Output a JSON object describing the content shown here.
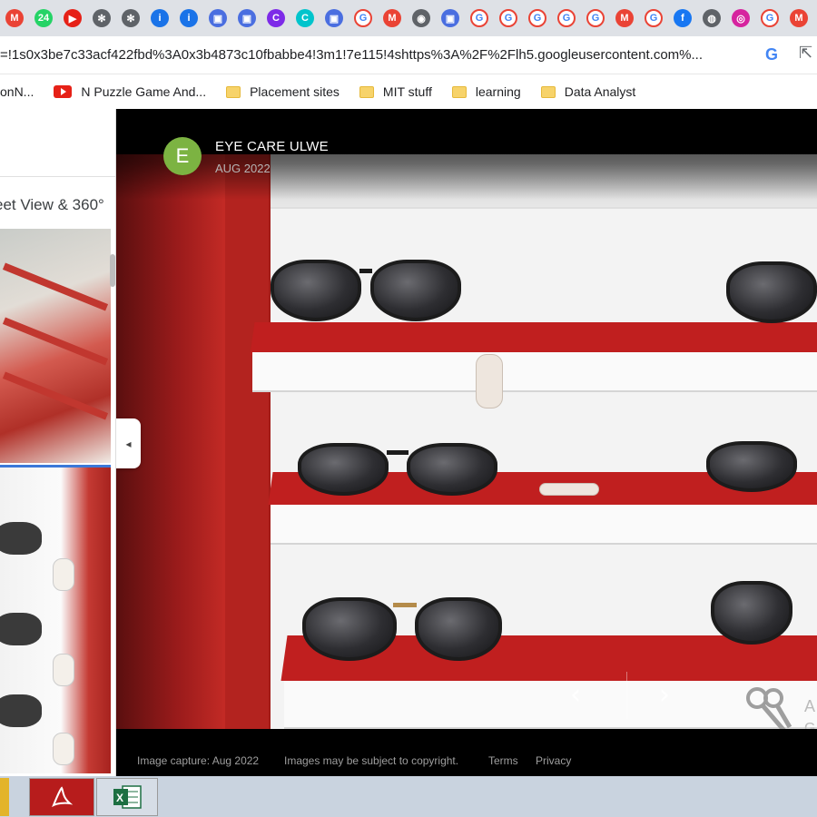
{
  "browser": {
    "tabs": [
      {
        "icon": "gmail-icon",
        "color": "#ea4335",
        "glyph": "M"
      },
      {
        "icon": "whatsapp-icon",
        "color": "#25d366",
        "glyph": "24"
      },
      {
        "icon": "youtube-icon",
        "color": "#e62117",
        "glyph": "▶"
      },
      {
        "icon": "avengers-icon",
        "color": "#5f6368",
        "glyph": "✻"
      },
      {
        "icon": "avengers-icon",
        "color": "#5f6368",
        "glyph": "✻"
      },
      {
        "icon": "info-icon",
        "color": "#1a73e8",
        "glyph": "i"
      },
      {
        "icon": "info-icon",
        "color": "#1a73e8",
        "glyph": "i"
      },
      {
        "icon": "bag-icon",
        "color": "#4a6ee0",
        "glyph": "▣"
      },
      {
        "icon": "bag-icon",
        "color": "#4a6ee0",
        "glyph": "▣"
      },
      {
        "icon": "canva-icon",
        "color": "#7d2ae8",
        "glyph": "C"
      },
      {
        "icon": "canva-icon",
        "color": "#00c4cc",
        "glyph": "C"
      },
      {
        "icon": "bag-icon",
        "color": "#4a6ee0",
        "glyph": "▣"
      },
      {
        "icon": "google-icon",
        "color": "#ffffff",
        "glyph": "G"
      },
      {
        "icon": "gmail-icon",
        "color": "#ea4335",
        "glyph": "M"
      },
      {
        "icon": "chrome-icon",
        "color": "#5f6368",
        "glyph": "◉"
      },
      {
        "icon": "bag-icon",
        "color": "#4a6ee0",
        "glyph": "▣"
      },
      {
        "icon": "google-icon",
        "color": "#ffffff",
        "glyph": "G"
      },
      {
        "icon": "google-icon",
        "color": "#ffffff",
        "glyph": "G"
      },
      {
        "icon": "google-icon",
        "color": "#ffffff",
        "glyph": "G"
      },
      {
        "icon": "google-icon",
        "color": "#ffffff",
        "glyph": "G"
      },
      {
        "icon": "google-icon",
        "color": "#ffffff",
        "glyph": "G"
      },
      {
        "icon": "gmail-icon",
        "color": "#ea4335",
        "glyph": "M"
      },
      {
        "icon": "google-icon",
        "color": "#ffffff",
        "glyph": "G"
      },
      {
        "icon": "facebook-icon",
        "color": "#1877f2",
        "glyph": "f"
      },
      {
        "icon": "globe-icon",
        "color": "#5f6368",
        "glyph": "◍"
      },
      {
        "icon": "instagram-icon",
        "color": "#d6249f",
        "glyph": "◎"
      },
      {
        "icon": "google-icon",
        "color": "#ffffff",
        "glyph": "G"
      },
      {
        "icon": "gmail-icon",
        "color": "#ea4335",
        "glyph": "M"
      }
    ],
    "url": "=!1s0x3be7c33acf422fbd%3A0x3b4873c10fbabbe4!3m1!7e115!4shttps%3A%2F%2Flh5.googleusercontent.com%...",
    "bookmarks": [
      {
        "label": "onN...",
        "icon": "none"
      },
      {
        "label": "N Puzzle Game And...",
        "icon": "youtube-icon"
      },
      {
        "label": "Placement sites",
        "icon": "folder-icon"
      },
      {
        "label": "MIT stuff",
        "icon": "folder-icon"
      },
      {
        "label": "learning",
        "icon": "folder-icon"
      },
      {
        "label": "Data Analyst",
        "icon": "folder-icon"
      }
    ]
  },
  "left_panel": {
    "label": "eet View & 360°"
  },
  "viewer": {
    "avatar_letter": "E",
    "place_title": "EYE CARE ULWE",
    "date": "AUG 2022",
    "side_letter_a": "A",
    "side_letter_g": "G",
    "prev_glyph": "‹",
    "next_glyph": "›",
    "collapse_glyph": "◂"
  },
  "footer": {
    "capture": "Image capture: Aug 2022",
    "copyright": "Images may be subject to copyright.",
    "terms": "Terms",
    "privacy": "Privacy"
  },
  "taskbar": {
    "items": [
      "acrobat-icon",
      "excel-icon"
    ]
  },
  "colors": {
    "accent_red": "#c01f1f",
    "avatar_green": "#7cb342"
  }
}
